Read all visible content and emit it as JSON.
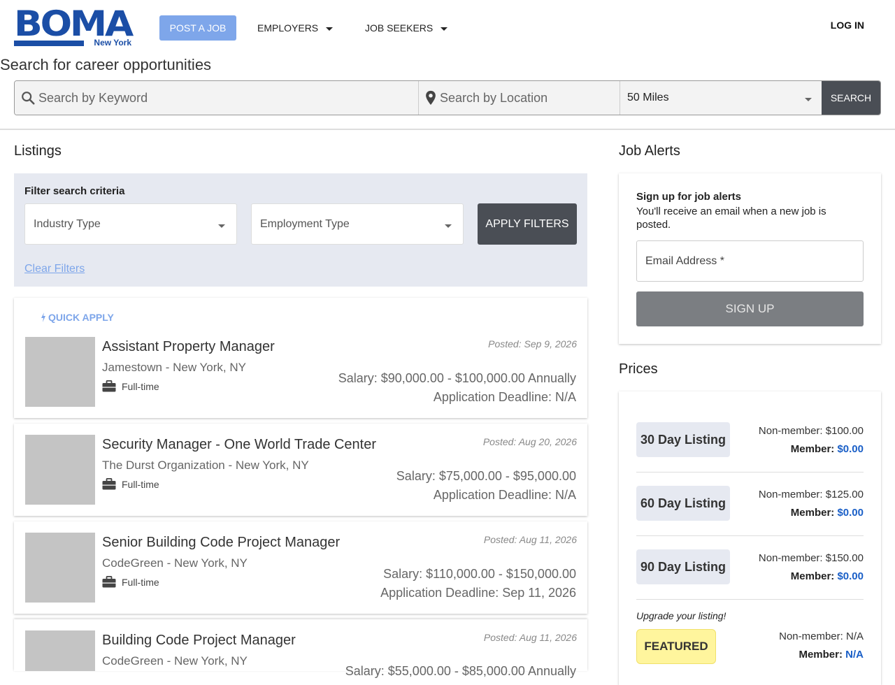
{
  "header": {
    "logo_text": "BOMA",
    "logo_sub": "New York",
    "post_job": "Post a Job",
    "employers": "Employers",
    "job_seekers": "Job Seekers",
    "login": "Log In"
  },
  "search": {
    "title": "Search for career opportunities",
    "keyword_placeholder": "Search by Keyword",
    "location_placeholder": "Search by Location",
    "radius": "50 Miles",
    "button": "Search"
  },
  "listings": {
    "heading": "Listings",
    "filter": {
      "title": "Filter search criteria",
      "industry": "Industry Type",
      "employment": "Employment Type",
      "apply": "Apply Filters",
      "clear": "Clear Filters"
    },
    "quick_apply": "Quick Apply",
    "jobs": [
      {
        "title": "Assistant Property Manager",
        "company": "Jamestown - New York, NY",
        "type": "Full-time",
        "posted": "Posted: Sep 9, 2026",
        "salary": "Salary: $90,000.00 - $100,000.00 Annually",
        "deadline": "Application Deadline: N/A"
      },
      {
        "title": "Security Manager - One World Trade Center",
        "company": "The Durst Organization - New York, NY",
        "type": "Full-time",
        "posted": "Posted: Aug 20, 2026",
        "salary": "Salary: $75,000.00 - $95,000.00",
        "deadline": "Application Deadline: N/A"
      },
      {
        "title": "Senior Building Code Project Manager",
        "company": "CodeGreen - New York, NY",
        "type": "Full-time",
        "posted": "Posted: Aug 11, 2026",
        "salary": "Salary: $110,000.00 - $150,000.00",
        "deadline": "Application Deadline: Sep 11, 2026"
      },
      {
        "title": "Building Code Project Manager",
        "company": "CodeGreen - New York, NY",
        "posted": "Posted: Aug 11, 2026",
        "salary": "Salary: $55,000.00 - $85,000.00 Annually"
      }
    ]
  },
  "alerts": {
    "heading": "Job Alerts",
    "title": "Sign up for job alerts",
    "desc": "You'll receive an email when a new job is posted.",
    "email_label": "Email Address *",
    "signup": "Sign Up"
  },
  "prices": {
    "heading": "Prices",
    "member_label": "Member:",
    "rows": [
      {
        "name": "30 Day Listing",
        "nonmember": "Non-member: $100.00",
        "member": "$0.00"
      },
      {
        "name": "60 Day Listing",
        "nonmember": "Non-member: $125.00",
        "member": "$0.00"
      },
      {
        "name": "90 Day Listing",
        "nonmember": "Non-member: $150.00",
        "member": "$0.00"
      }
    ],
    "upgrade": "Upgrade your listing!",
    "featured": "Featured",
    "featured_nonmember": "Non-member: N/A",
    "featured_member": "N/A"
  },
  "colors": {
    "brand": "#1b4ea6",
    "accent_light": "#7ea6ea",
    "dark_button": "#4a4e55",
    "member_price": "#1a5fc7",
    "featured_bg": "#fff59d"
  }
}
